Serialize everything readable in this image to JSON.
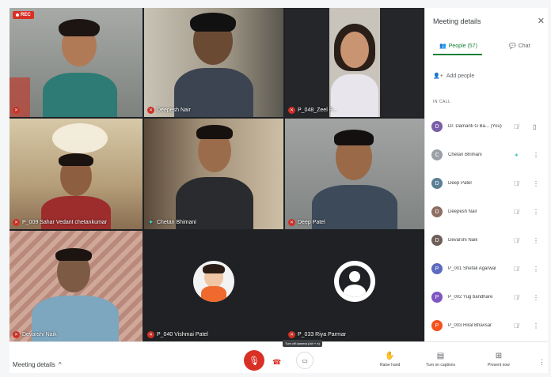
{
  "recording": {
    "label": "REC"
  },
  "tiles": [
    {
      "name": "Dr. Damanti G Ba...",
      "label": "",
      "muted": true
    },
    {
      "name": "Deepesh Nair",
      "muted": true
    },
    {
      "name": "P_048_Zeel P...",
      "muted": true
    },
    {
      "name": "P_009 Sahar Vedant chetankumar",
      "muted": true
    },
    {
      "name": "Chetan Bhimani",
      "muted": false
    },
    {
      "name": "Deep Patel",
      "muted": true
    },
    {
      "name": "Devarshi Naik",
      "muted": true
    },
    {
      "name": "P_040 Vishmai Patel",
      "muted": true
    },
    {
      "name": "P_033 Riya Parmar",
      "muted": true
    }
  ],
  "sidebar": {
    "title": "Meeting details",
    "close_icon": "close-icon",
    "tab_people": "People (57)",
    "tab_chat": "Chat",
    "add_people": "Add people",
    "in_call": "IN CALL",
    "participants": [
      {
        "name": "Dr. Damanti G Ba... (You)",
        "color": "#7b5ea7",
        "initial": "D"
      },
      {
        "name": "Chetan Bhimani",
        "color": "#9aa0a6",
        "initial": "C"
      },
      {
        "name": "Deep Patel",
        "color": "#5b7f95",
        "initial": "D"
      },
      {
        "name": "Deepesh Nair",
        "color": "#8d6e63",
        "initial": "D"
      },
      {
        "name": "Devarshi Naik",
        "color": "#6d5f58",
        "initial": "D"
      },
      {
        "name": "P_001 Shefali Agarwal",
        "color": "#5c6bc0",
        "initial": "P"
      },
      {
        "name": "P_002 Yug bandhare",
        "color": "#7e57c2",
        "initial": "P"
      },
      {
        "name": "P_003 Hiral Bhavsar",
        "color": "#f4511e",
        "initial": "P"
      }
    ]
  },
  "bottombar": {
    "meeting_details": "Meeting details",
    "camera_tooltip": "Turn off camera (ctrl + e)",
    "raise_hand": "Raise hand",
    "captions": "Turn on captions",
    "present": "Present now"
  }
}
